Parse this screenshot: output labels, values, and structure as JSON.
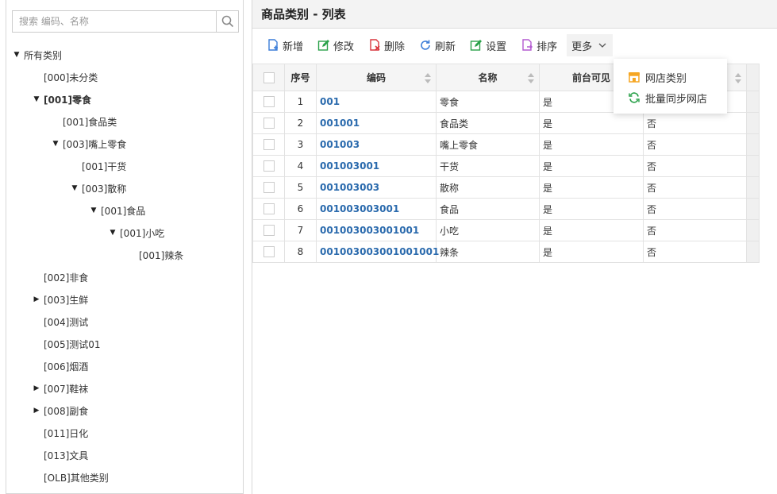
{
  "search": {
    "placeholder": "搜索 编码、名称"
  },
  "tree": [
    {
      "label": "所有类别",
      "arrow": "down",
      "bold": false
    },
    {
      "label": "[000]未分类",
      "arrow": "",
      "bold": false
    },
    {
      "label": "[001]零食",
      "arrow": "down",
      "bold": true
    },
    {
      "label": "[001]食品类",
      "arrow": "",
      "bold": false
    },
    {
      "label": "[003]嘴上零食",
      "arrow": "down",
      "bold": false
    },
    {
      "label": "[001]干货",
      "arrow": "",
      "bold": false
    },
    {
      "label": "[003]散称",
      "arrow": "down",
      "bold": false
    },
    {
      "label": "[001]食品",
      "arrow": "down",
      "bold": false
    },
    {
      "label": "[001]小吃",
      "arrow": "down",
      "bold": false
    },
    {
      "label": "[001]辣条",
      "arrow": "",
      "bold": false
    },
    {
      "label": "[002]非食",
      "arrow": "",
      "bold": false
    },
    {
      "label": "[003]生鲜",
      "arrow": "right",
      "bold": false
    },
    {
      "label": "[004]测试",
      "arrow": "",
      "bold": false
    },
    {
      "label": "[005]测试01",
      "arrow": "",
      "bold": false
    },
    {
      "label": "[006]烟酒",
      "arrow": "",
      "bold": false
    },
    {
      "label": "[007]鞋袜",
      "arrow": "right",
      "bold": false
    },
    {
      "label": "[008]副食",
      "arrow": "right",
      "bold": false
    },
    {
      "label": "[011]日化",
      "arrow": "",
      "bold": false
    },
    {
      "label": "[013]文具",
      "arrow": "",
      "bold": false
    },
    {
      "label": "[OLB]其他类别",
      "arrow": "",
      "bold": false
    }
  ],
  "page_title": "商品类别 - 列表",
  "toolbar": {
    "add": "新增",
    "edit": "修改",
    "delete": "删除",
    "refresh": "刷新",
    "settings": "设置",
    "sort": "排序",
    "more": "更多"
  },
  "more_menu": {
    "shop_category": "网店类别",
    "batch_sync": "批量同步网店"
  },
  "table": {
    "headers": {
      "index": "序号",
      "code": "编码",
      "name": "名称",
      "visible": "前台可见"
    },
    "rows": [
      {
        "index": "1",
        "code": "001",
        "name": "零食",
        "visible": "是",
        "extra": ""
      },
      {
        "index": "2",
        "code": "001001",
        "name": "食品类",
        "visible": "是",
        "extra": "否"
      },
      {
        "index": "3",
        "code": "001003",
        "name": "嘴上零食",
        "visible": "是",
        "extra": "否"
      },
      {
        "index": "4",
        "code": "001003001",
        "name": "干货",
        "visible": "是",
        "extra": "否"
      },
      {
        "index": "5",
        "code": "001003003",
        "name": "散称",
        "visible": "是",
        "extra": "否"
      },
      {
        "index": "6",
        "code": "001003003001",
        "name": "食品",
        "visible": "是",
        "extra": "否"
      },
      {
        "index": "7",
        "code": "001003003001001",
        "name": "小吃",
        "visible": "是",
        "extra": "否"
      },
      {
        "index": "8",
        "code": "001003003001001001",
        "name": "辣条",
        "visible": "是",
        "extra": "否"
      }
    ]
  },
  "colors": {
    "code_link": "#2a6aad",
    "add_icon": "#3b7dd8",
    "edit_icon": "#2aa14a",
    "delete_icon": "#d9363e",
    "refresh_icon": "#3b7dd8",
    "settings_icon": "#2aa14a",
    "sort_icon": "#b45ad1"
  }
}
